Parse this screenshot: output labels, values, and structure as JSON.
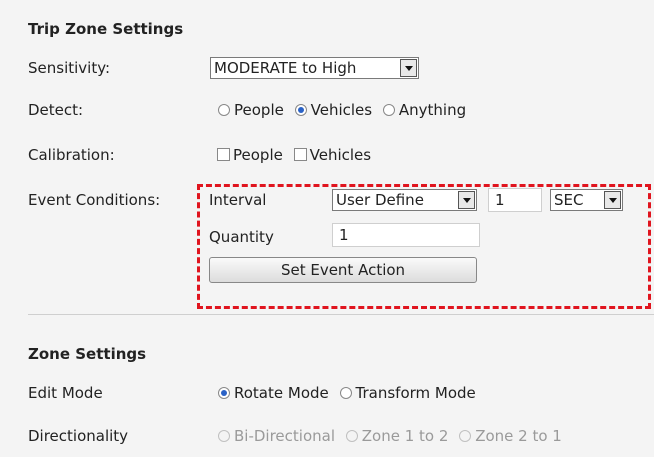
{
  "trip_zone": {
    "title": "Trip Zone Settings",
    "sensitivity": {
      "label": "Sensitivity:",
      "value": "MODERATE to High"
    },
    "detect": {
      "label": "Detect:",
      "options": [
        "People",
        "Vehicles",
        "Anything"
      ],
      "selected": "Vehicles"
    },
    "calibration": {
      "label": "Calibration:",
      "options": [
        "People",
        "Vehicles"
      ]
    },
    "event_conditions": {
      "label": "Event Conditions:",
      "interval_label": "Interval",
      "interval_mode": "User Define",
      "interval_value": "1",
      "interval_unit": "SEC",
      "quantity_label": "Quantity",
      "quantity_value": "1",
      "set_event_action": "Set Event Action"
    }
  },
  "zone_settings": {
    "title": "Zone Settings",
    "edit_mode": {
      "label": "Edit Mode",
      "options": [
        "Rotate Mode",
        "Transform Mode"
      ],
      "selected": "Rotate Mode"
    },
    "directionality": {
      "label": "Directionality",
      "options": [
        "Bi-Directional",
        "Zone 1 to 2",
        "Zone 2 to 1"
      ]
    }
  },
  "colors": {
    "highlight_border": "#e0141e",
    "radio_selected": "#2a62c6"
  },
  "icons": [
    "dropdown-arrow-icon",
    "radio-icon",
    "checkbox-icon"
  ]
}
